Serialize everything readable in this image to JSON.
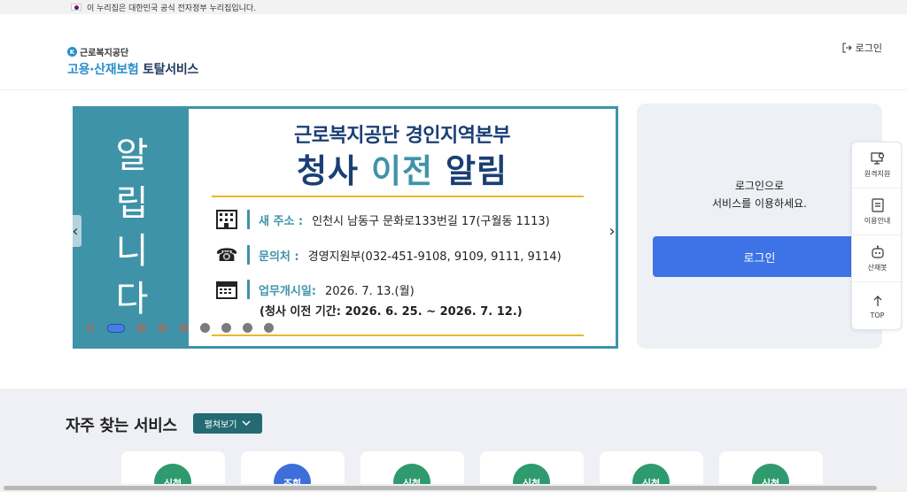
{
  "gov_banner": {
    "text": "이 누리집은 대한민국 공식 전자정부 누리집입니다."
  },
  "header": {
    "logo_org": "근로복지공단",
    "logo_main_a": "고용·산재보험",
    "logo_main_b": "토탈서비스",
    "login_label": "로그인"
  },
  "notice": {
    "side_chars": [
      "알",
      "립",
      "니",
      "다"
    ],
    "org": "근로복지공단 경인지역본부",
    "title_a": "청사",
    "title_b": "이전",
    "title_c": "알림",
    "rows": [
      {
        "icon": "building-icon",
        "label": "새 주소 :",
        "value": "인천시 남동구 문화로133번길 17(구월동 1113)"
      },
      {
        "icon": "phone-icon",
        "label": "문의처 :",
        "value": "경영지원부(032-451-9108, 9109, 9111, 9114)"
      },
      {
        "icon": "calendar-icon",
        "label": "업무개시일:",
        "value": "2026. 7. 13.(월)"
      }
    ],
    "sub": "(청사 이전 기간: 2026. 6. 25. ~ 2026. 7. 12.)"
  },
  "carousel": {
    "slide_count": 8,
    "active_index": 0,
    "prev_glyph": "‹",
    "next_glyph": "›"
  },
  "login_panel": {
    "line1": "로그인으로",
    "line2": "서비스를 이용하세요.",
    "button": "로그인"
  },
  "quick_menu": [
    {
      "label": "원격지원",
      "icon": "remote-support-icon"
    },
    {
      "label": "이용안내",
      "icon": "guide-icon"
    },
    {
      "label": "산재봇",
      "icon": "chatbot-icon"
    },
    {
      "label": "TOP",
      "icon": "arrow-up-icon"
    }
  ],
  "services": {
    "title": "자주 찾는 서비스",
    "expand_label": "펼쳐보기",
    "cards": [
      {
        "badge": "신청",
        "color": "#2e9a6e"
      },
      {
        "badge": "조회",
        "color": "#3d6ed9"
      },
      {
        "badge": "신청",
        "color": "#2e9a6e"
      },
      {
        "badge": "신청",
        "color": "#2e9a6e"
      },
      {
        "badge": "신청",
        "color": "#2e9a6e"
      },
      {
        "badge": "신청",
        "color": "#2e9a6e"
      }
    ]
  },
  "colors": {
    "teal": "#3f93a8",
    "navy": "#1a3f73",
    "gold": "#e8b829",
    "login_blue": "#3d73e6",
    "expand_green": "#246a73"
  }
}
